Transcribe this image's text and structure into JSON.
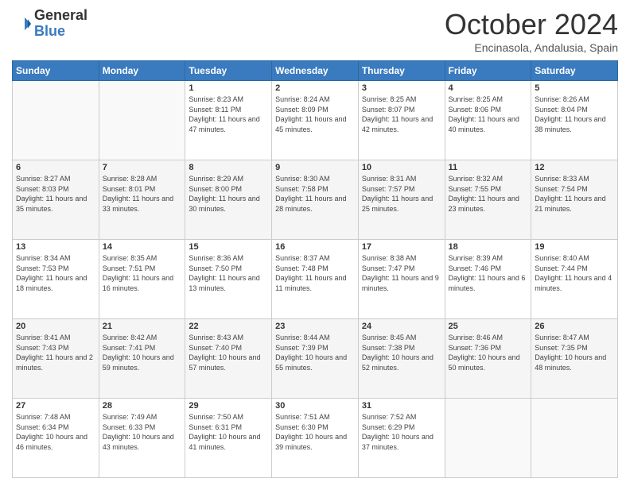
{
  "logo": {
    "general": "General",
    "blue": "Blue"
  },
  "header": {
    "month": "October 2024",
    "location": "Encinasola, Andalusia, Spain"
  },
  "weekdays": [
    "Sunday",
    "Monday",
    "Tuesday",
    "Wednesday",
    "Thursday",
    "Friday",
    "Saturday"
  ],
  "weeks": [
    [
      {
        "day": "",
        "info": ""
      },
      {
        "day": "",
        "info": ""
      },
      {
        "day": "1",
        "info": "Sunrise: 8:23 AM\nSunset: 8:11 PM\nDaylight: 11 hours and 47 minutes."
      },
      {
        "day": "2",
        "info": "Sunrise: 8:24 AM\nSunset: 8:09 PM\nDaylight: 11 hours and 45 minutes."
      },
      {
        "day": "3",
        "info": "Sunrise: 8:25 AM\nSunset: 8:07 PM\nDaylight: 11 hours and 42 minutes."
      },
      {
        "day": "4",
        "info": "Sunrise: 8:25 AM\nSunset: 8:06 PM\nDaylight: 11 hours and 40 minutes."
      },
      {
        "day": "5",
        "info": "Sunrise: 8:26 AM\nSunset: 8:04 PM\nDaylight: 11 hours and 38 minutes."
      }
    ],
    [
      {
        "day": "6",
        "info": "Sunrise: 8:27 AM\nSunset: 8:03 PM\nDaylight: 11 hours and 35 minutes."
      },
      {
        "day": "7",
        "info": "Sunrise: 8:28 AM\nSunset: 8:01 PM\nDaylight: 11 hours and 33 minutes."
      },
      {
        "day": "8",
        "info": "Sunrise: 8:29 AM\nSunset: 8:00 PM\nDaylight: 11 hours and 30 minutes."
      },
      {
        "day": "9",
        "info": "Sunrise: 8:30 AM\nSunset: 7:58 PM\nDaylight: 11 hours and 28 minutes."
      },
      {
        "day": "10",
        "info": "Sunrise: 8:31 AM\nSunset: 7:57 PM\nDaylight: 11 hours and 25 minutes."
      },
      {
        "day": "11",
        "info": "Sunrise: 8:32 AM\nSunset: 7:55 PM\nDaylight: 11 hours and 23 minutes."
      },
      {
        "day": "12",
        "info": "Sunrise: 8:33 AM\nSunset: 7:54 PM\nDaylight: 11 hours and 21 minutes."
      }
    ],
    [
      {
        "day": "13",
        "info": "Sunrise: 8:34 AM\nSunset: 7:53 PM\nDaylight: 11 hours and 18 minutes."
      },
      {
        "day": "14",
        "info": "Sunrise: 8:35 AM\nSunset: 7:51 PM\nDaylight: 11 hours and 16 minutes."
      },
      {
        "day": "15",
        "info": "Sunrise: 8:36 AM\nSunset: 7:50 PM\nDaylight: 11 hours and 13 minutes."
      },
      {
        "day": "16",
        "info": "Sunrise: 8:37 AM\nSunset: 7:48 PM\nDaylight: 11 hours and 11 minutes."
      },
      {
        "day": "17",
        "info": "Sunrise: 8:38 AM\nSunset: 7:47 PM\nDaylight: 11 hours and 9 minutes."
      },
      {
        "day": "18",
        "info": "Sunrise: 8:39 AM\nSunset: 7:46 PM\nDaylight: 11 hours and 6 minutes."
      },
      {
        "day": "19",
        "info": "Sunrise: 8:40 AM\nSunset: 7:44 PM\nDaylight: 11 hours and 4 minutes."
      }
    ],
    [
      {
        "day": "20",
        "info": "Sunrise: 8:41 AM\nSunset: 7:43 PM\nDaylight: 11 hours and 2 minutes."
      },
      {
        "day": "21",
        "info": "Sunrise: 8:42 AM\nSunset: 7:41 PM\nDaylight: 10 hours and 59 minutes."
      },
      {
        "day": "22",
        "info": "Sunrise: 8:43 AM\nSunset: 7:40 PM\nDaylight: 10 hours and 57 minutes."
      },
      {
        "day": "23",
        "info": "Sunrise: 8:44 AM\nSunset: 7:39 PM\nDaylight: 10 hours and 55 minutes."
      },
      {
        "day": "24",
        "info": "Sunrise: 8:45 AM\nSunset: 7:38 PM\nDaylight: 10 hours and 52 minutes."
      },
      {
        "day": "25",
        "info": "Sunrise: 8:46 AM\nSunset: 7:36 PM\nDaylight: 10 hours and 50 minutes."
      },
      {
        "day": "26",
        "info": "Sunrise: 8:47 AM\nSunset: 7:35 PM\nDaylight: 10 hours and 48 minutes."
      }
    ],
    [
      {
        "day": "27",
        "info": "Sunrise: 7:48 AM\nSunset: 6:34 PM\nDaylight: 10 hours and 46 minutes."
      },
      {
        "day": "28",
        "info": "Sunrise: 7:49 AM\nSunset: 6:33 PM\nDaylight: 10 hours and 43 minutes."
      },
      {
        "day": "29",
        "info": "Sunrise: 7:50 AM\nSunset: 6:31 PM\nDaylight: 10 hours and 41 minutes."
      },
      {
        "day": "30",
        "info": "Sunrise: 7:51 AM\nSunset: 6:30 PM\nDaylight: 10 hours and 39 minutes."
      },
      {
        "day": "31",
        "info": "Sunrise: 7:52 AM\nSunset: 6:29 PM\nDaylight: 10 hours and 37 minutes."
      },
      {
        "day": "",
        "info": ""
      },
      {
        "day": "",
        "info": ""
      }
    ]
  ]
}
